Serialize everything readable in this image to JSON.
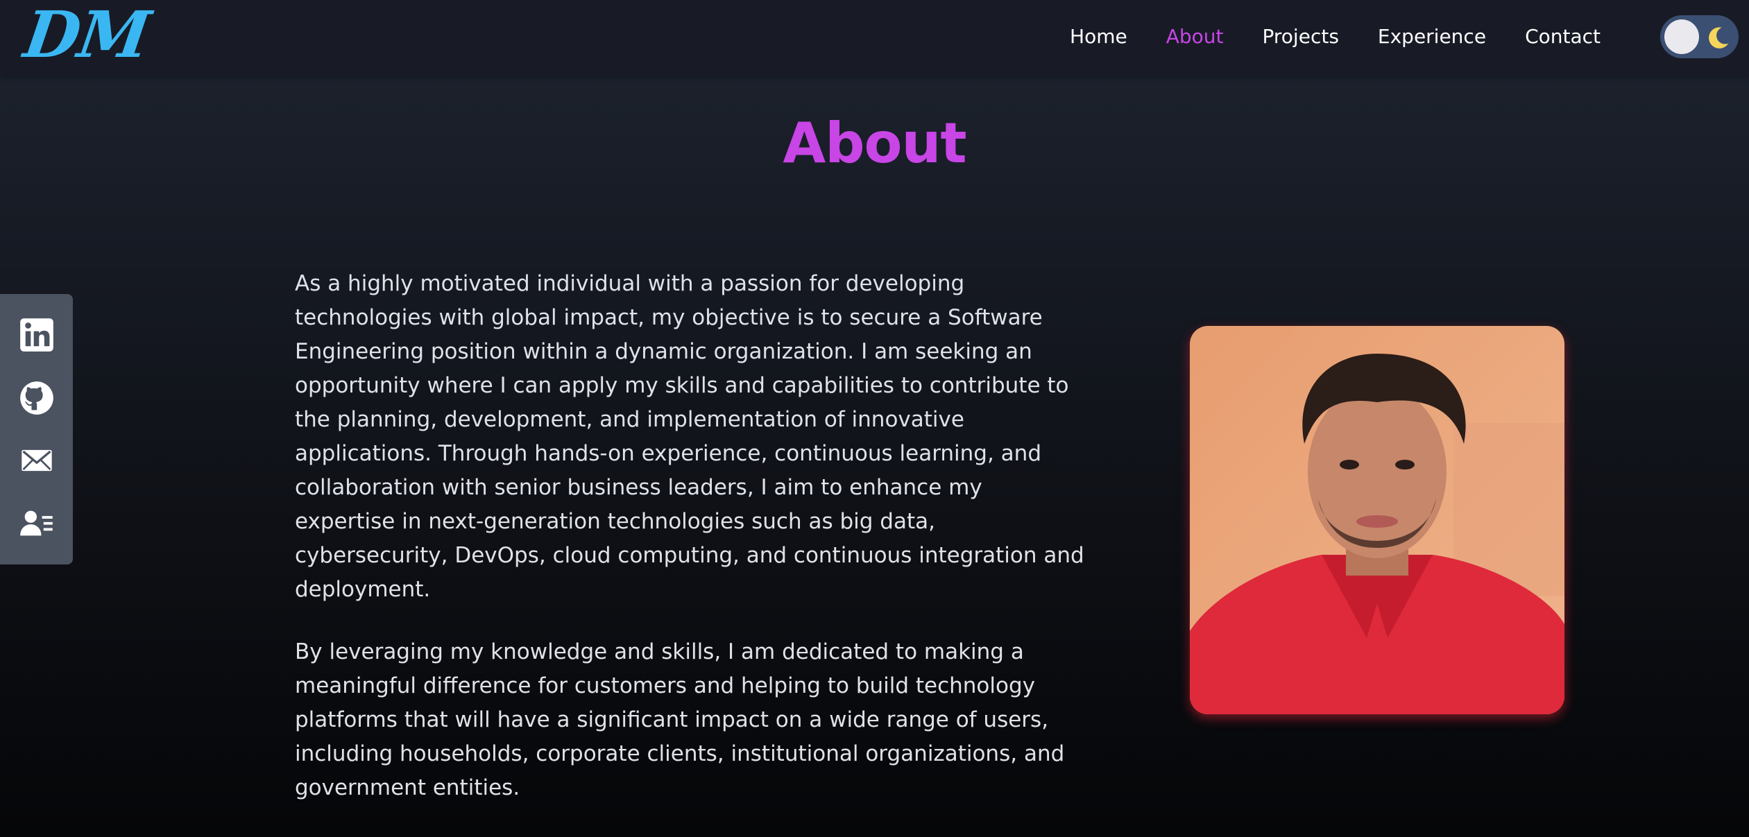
{
  "header": {
    "logo_text": "DM",
    "nav": [
      {
        "label": "Home",
        "active": false
      },
      {
        "label": "About",
        "active": true
      },
      {
        "label": "Projects",
        "active": false
      },
      {
        "label": "Experience",
        "active": false
      },
      {
        "label": "Contact",
        "active": false
      }
    ],
    "theme_toggle": {
      "mode": "dark",
      "icon": "moon-icon"
    }
  },
  "social": [
    {
      "name": "linkedin",
      "icon": "linkedin-icon"
    },
    {
      "name": "github",
      "icon": "github-icon"
    },
    {
      "name": "email",
      "icon": "mail-icon"
    },
    {
      "name": "resume",
      "icon": "contact-card-icon"
    }
  ],
  "main": {
    "title": "About",
    "paragraphs": [
      "As a highly motivated individual with a passion for developing technologies with global impact, my objective is to secure a Software Engineering position within a dynamic organization. I am seeking an opportunity where I can apply my skills and capabilities to contribute to the planning, development, and implementation of innovative applications. Through hands-on experience, continuous learning, and collaboration with senior business leaders, I aim to enhance my expertise in next-generation technologies such as big data, cybersecurity, DevOps, cloud computing, and continuous integration and deployment.",
      "By leveraging my knowledge and skills, I am dedicated to making a meaningful difference for customers and helping to build technology platforms that will have a significant impact on a wide range of users, including households, corporate clients, institutional organizations, and government entities."
    ],
    "photo": {
      "subject": "profile-photo"
    }
  },
  "colors": {
    "accent": "#c845e6",
    "logo": "#3ab7f2",
    "header_bg": "#181b26",
    "sidebar_bg": "#4b5260",
    "text": "#dfe2e8"
  }
}
